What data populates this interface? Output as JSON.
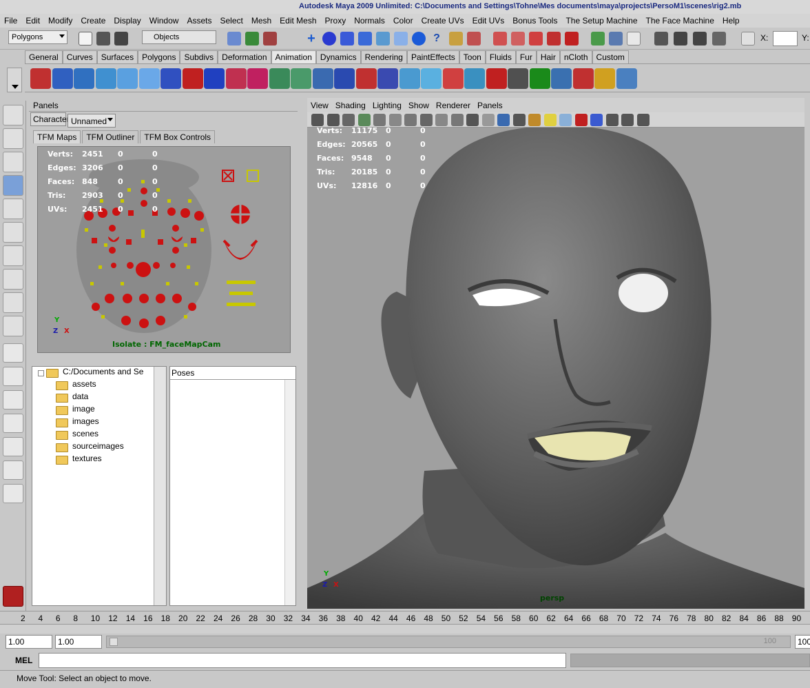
{
  "window": {
    "title": "Autodesk Maya 2009 Unlimited: C:\\Documents and Settings\\Tohne\\Mes documents\\maya\\projects\\PersoM1\\scenes\\rig2.mb"
  },
  "menu": [
    "File",
    "Edit",
    "Modify",
    "Create",
    "Display",
    "Window",
    "Assets",
    "Select",
    "Mesh",
    "Edit Mesh",
    "Proxy",
    "Normals",
    "Color",
    "Create UVs",
    "Edit UVs",
    "Bonus Tools",
    "The Setup Machine",
    "The Face Machine",
    "Help"
  ],
  "status": {
    "mode": "Polygons",
    "selection_mask": "Objects",
    "x_label": "X:",
    "y_label": "Y:"
  },
  "shelf_tabs": [
    "General",
    "Curves",
    "Surfaces",
    "Polygons",
    "Subdivs",
    "Deformation",
    "Animation",
    "Dynamics",
    "Rendering",
    "PaintEffects",
    "Toon",
    "Fluids",
    "Fur",
    "Hair",
    "nCloth",
    "Custom"
  ],
  "shelf_active": "Animation",
  "left_panel": {
    "panels_menu": "Panels",
    "character_label": "Character",
    "character_value": "Unnamed",
    "tabs": [
      "TFM Maps",
      "TFM Outliner",
      "TFM Box Controls"
    ],
    "hud": [
      {
        "label": "Verts:",
        "v1": "2451",
        "v2": "0",
        "v3": "0"
      },
      {
        "label": "Edges:",
        "v1": "3206",
        "v2": "0",
        "v3": "0"
      },
      {
        "label": "Faces:",
        "v1": "848",
        "v2": "0",
        "v3": "0"
      },
      {
        "label": "Tris:",
        "v1": "2903",
        "v2": "0",
        "v3": "0"
      },
      {
        "label": "UVs:",
        "v1": "2451",
        "v2": "0",
        "v3": "0"
      }
    ],
    "isolate": "Isolate : FM_faceMapCam",
    "axis_y": "Y",
    "axis_z": "Z",
    "axis_x": "X",
    "tree_root": "C:/Documents and Se",
    "tree_items": [
      "assets",
      "data",
      "image",
      "images",
      "scenes",
      "sourceimages",
      "textures"
    ],
    "poses_label": "Poses"
  },
  "viewport": {
    "menu": [
      "View",
      "Shading",
      "Lighting",
      "Show",
      "Renderer",
      "Panels"
    ],
    "hud": [
      {
        "label": "Verts:",
        "v1": "11175",
        "v2": "0",
        "v3": "0"
      },
      {
        "label": "Edges:",
        "v1": "20565",
        "v2": "0",
        "v3": "0"
      },
      {
        "label": "Faces:",
        "v1": "9548",
        "v2": "0",
        "v3": "0"
      },
      {
        "label": "Tris:",
        "v1": "20185",
        "v2": "0",
        "v3": "0"
      },
      {
        "label": "UVs:",
        "v1": "12816",
        "v2": "0",
        "v3": "0"
      }
    ],
    "camera": "persp",
    "axis_y": "Y",
    "axis_z": "Z",
    "axis_x": "X"
  },
  "timeline": {
    "ticks": [
      "2",
      "4",
      "6",
      "8",
      "10",
      "12",
      "14",
      "16",
      "18",
      "20",
      "22",
      "24",
      "26",
      "28",
      "30",
      "32",
      "34",
      "36",
      "38",
      "40",
      "42",
      "44",
      "46",
      "48",
      "50",
      "52",
      "54",
      "56",
      "58",
      "60",
      "62",
      "64",
      "66",
      "68",
      "70",
      "72",
      "74",
      "76",
      "78",
      "80",
      "82",
      "84",
      "86",
      "88",
      "90"
    ],
    "start": "1.00",
    "playback_start": "1.00",
    "range_end_label": "100",
    "end": "100"
  },
  "command_line": {
    "label": "MEL"
  },
  "help_line": "Move Tool: Select an object to move."
}
